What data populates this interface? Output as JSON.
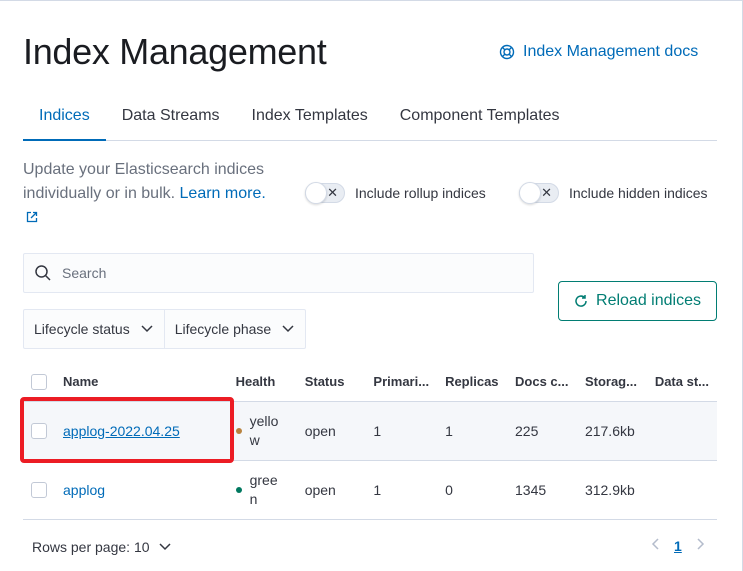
{
  "header": {
    "title": "Index Management",
    "docs_link": "Index Management docs"
  },
  "tabs": [
    {
      "label": "Indices",
      "active": true
    },
    {
      "label": "Data Streams",
      "active": false
    },
    {
      "label": "Index Templates",
      "active": false
    },
    {
      "label": "Component Templates",
      "active": false
    }
  ],
  "description": {
    "text": "Update your Elasticsearch indices individually or in bulk.",
    "learn_more": "Learn more."
  },
  "toggles": {
    "rollup": {
      "label": "Include rollup indices",
      "checked": false
    },
    "hidden": {
      "label": "Include hidden indices",
      "checked": false
    }
  },
  "search": {
    "placeholder": "Search"
  },
  "reload_button": "Reload indices",
  "filters": {
    "lifecycle_status": "Lifecycle status",
    "lifecycle_phase": "Lifecycle phase"
  },
  "table": {
    "columns": [
      "Name",
      "Health",
      "Status",
      "Primari...",
      "Replicas",
      "Docs c...",
      "Storag...",
      "Data st..."
    ],
    "rows": [
      {
        "name": "applog-2022.04.25",
        "health": "yellow",
        "health_color": "#b9833f",
        "status": "open",
        "primaries": "1",
        "replicas": "1",
        "docs": "225",
        "storage": "217.6kb",
        "data_stream": ""
      },
      {
        "name": "applog",
        "health": "green",
        "health_color": "#00785f",
        "status": "open",
        "primaries": "1",
        "replicas": "0",
        "docs": "1345",
        "storage": "312.9kb",
        "data_stream": ""
      }
    ]
  },
  "pagination": {
    "rows_per_page_label": "Rows per page: 10",
    "current_page": "1"
  },
  "colors": {
    "link": "#006bb8",
    "success": "#017d73",
    "highlight": "#ec1c24"
  }
}
